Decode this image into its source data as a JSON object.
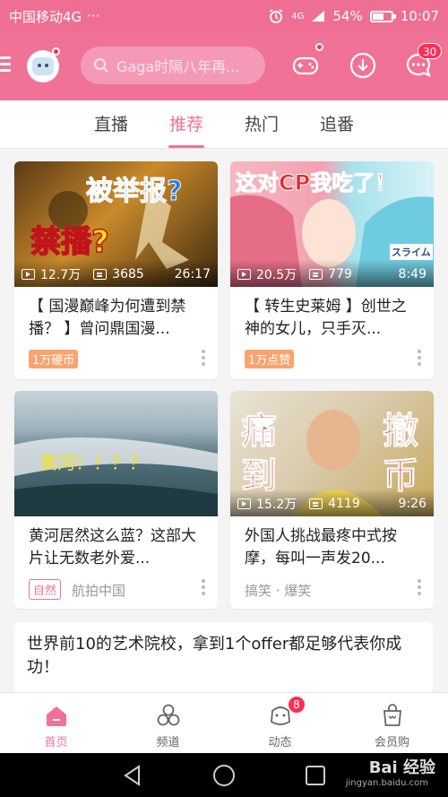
{
  "status_bar": {
    "carrier": "中国移动4G",
    "dots": "···",
    "network": "4G",
    "battery": "54%",
    "time": "10:07"
  },
  "header": {
    "search_placeholder": "Gaga时隔八年再...",
    "message_badge": "30"
  },
  "tabs": [
    {
      "label": "直播"
    },
    {
      "label": "推荐"
    },
    {
      "label": "热门"
    },
    {
      "label": "追番"
    }
  ],
  "cards": [
    {
      "title": "【 国漫巅峰为何遭到禁播？ 】曾问鼎国漫...",
      "views": "12.7万",
      "danmaku": "3685",
      "duration": "26:17",
      "tag": "1万硬币",
      "thumb_text_1": "被举报?",
      "thumb_text_2": "禁播?"
    },
    {
      "title": "【 转生史莱姆 】创世之神的女儿，只手灭...",
      "views": "20.5万",
      "danmaku": "779",
      "duration": "8:49",
      "tag": "1万点赞",
      "thumb_text_1": "这对CP我吃了！",
      "thumb_text_2": "スライム"
    },
    {
      "title": "黄河居然这么蓝？这部大片让无数老外爱...",
      "tag": "自然",
      "meta": "航拍中国",
      "thumb_text_1": "黄河！！？？"
    },
    {
      "title": "外国人挑战最疼中式按摩，每叫一声发20...",
      "views": "15.2万",
      "danmaku": "4119",
      "duration": "9:26",
      "meta": "搞笑 · 爆笑",
      "thumb_text_1": "痛",
      "thumb_text_2": "到",
      "thumb_text_3": "撤",
      "thumb_text_4": "币"
    }
  ],
  "article": {
    "title": "世界前10的艺术院校，拿到1个offer都足够代表你成功！"
  },
  "bottom_nav": [
    {
      "label": "首页",
      "icon": "home-icon"
    },
    {
      "label": "频道",
      "icon": "channel-icon"
    },
    {
      "label": "动态",
      "icon": "feed-icon",
      "badge": "8"
    },
    {
      "label": "会员购",
      "icon": "shop-icon"
    }
  ],
  "watermark": {
    "text": "Bai 经验",
    "sub": "jingyan.baidu.com"
  },
  "colors": {
    "brand_pink": "#f07297",
    "badge_red": "#ff2d55",
    "tag_orange": "#f9a46e"
  }
}
